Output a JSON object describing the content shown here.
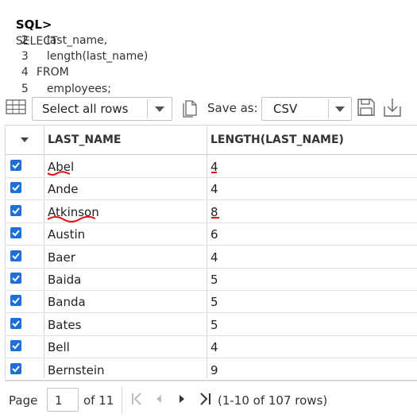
{
  "sql": {
    "prompt": "SQL>",
    "lines": [
      {
        "num": "",
        "text": "SELECT"
      },
      {
        "num": "2",
        "text": "last_name,"
      },
      {
        "num": "3",
        "text": "length(last_name)"
      },
      {
        "num": "4",
        "text": "FROM"
      },
      {
        "num": "5",
        "text": "employees;"
      }
    ]
  },
  "toolbar": {
    "select_rows_value": "Select all rows",
    "save_as_label": "Save as:",
    "format_value": "CSV",
    "icons": [
      "table-icon",
      "copy-icon",
      "save-icon",
      "download-icon"
    ]
  },
  "grid": {
    "columns": [
      "LAST_NAME",
      "LENGTH(LAST_NAME)"
    ],
    "rows": [
      {
        "last_name": "Abel",
        "length": "4",
        "checked": true
      },
      {
        "last_name": "Ande",
        "length": "4",
        "checked": true
      },
      {
        "last_name": "Atkinson",
        "length": "8",
        "checked": true
      },
      {
        "last_name": "Austin",
        "length": "6",
        "checked": true
      },
      {
        "last_name": "Baer",
        "length": "4",
        "checked": true
      },
      {
        "last_name": "Baida",
        "length": "5",
        "checked": true
      },
      {
        "last_name": "Banda",
        "length": "5",
        "checked": true
      },
      {
        "last_name": "Bates",
        "length": "5",
        "checked": true
      },
      {
        "last_name": "Bell",
        "length": "4",
        "checked": true
      },
      {
        "last_name": "Bernstein",
        "length": "9",
        "checked": true
      }
    ]
  },
  "pager": {
    "page_label": "Page",
    "page_value": "1",
    "of_label": "of 11",
    "rows_info": "(1-10 of 107 rows)"
  },
  "colors": {
    "checkbox": "#1f6fd8",
    "annotation": "#e0101a"
  }
}
